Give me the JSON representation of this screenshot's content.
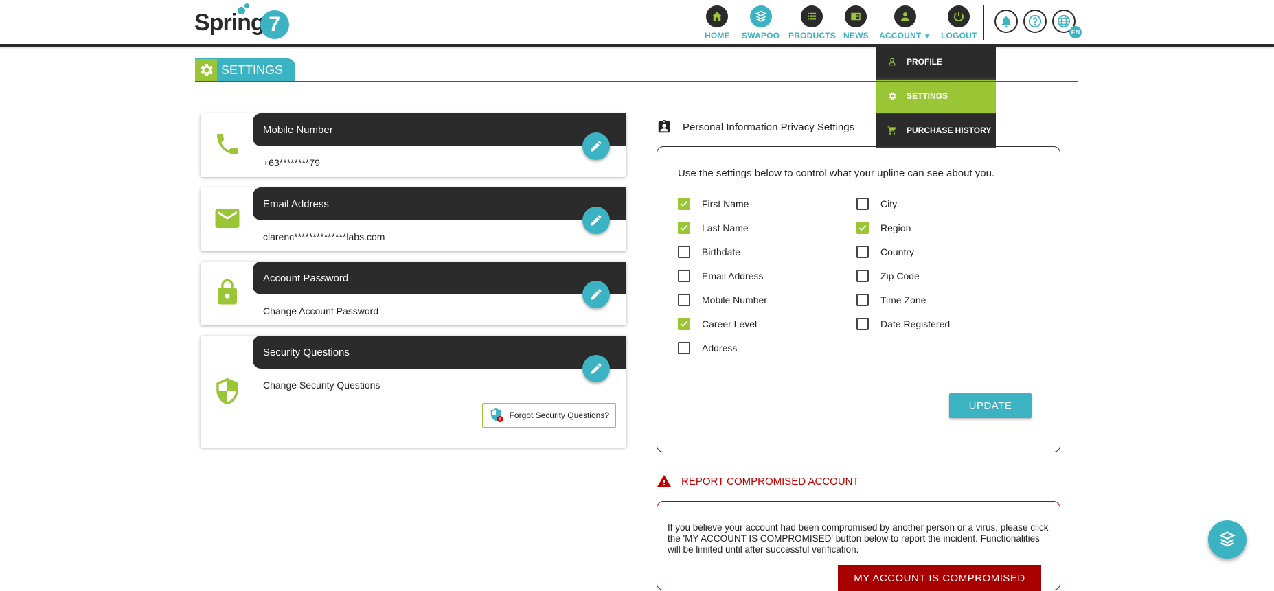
{
  "brand": {
    "logo_text": "Spring",
    "logo_number": "7"
  },
  "nav": {
    "home": "HOME",
    "swapoo": "SWAPOO",
    "products": "PRODUCTS",
    "news": "NEWS",
    "account": "ACCOUNT",
    "logout": "LOGOUT",
    "language": "EN"
  },
  "account_menu": {
    "items": [
      {
        "label": "PROFILE",
        "icon": "person-icon"
      },
      {
        "label": "SETTINGS",
        "icon": "gear-icon",
        "active": true
      },
      {
        "label": "PURCHASE HISTORY",
        "icon": "cart-icon"
      }
    ]
  },
  "page": {
    "title": "SETTINGS"
  },
  "cards": [
    {
      "title": "Mobile Number",
      "value": "+63********79",
      "icon": "phone-icon"
    },
    {
      "title": "Email Address",
      "value": "clarenc**************labs.com",
      "icon": "email-icon"
    },
    {
      "title": "Account Password",
      "value": "Change Account Password",
      "icon": "lock-icon"
    },
    {
      "title": "Security Questions",
      "value": "Change Security Questions",
      "icon": "shield-icon",
      "extra_button": "Forgot Security Questions?"
    }
  ],
  "privacy": {
    "title": "Personal Information Privacy Settings",
    "intro": "Use the settings below to control what your upline can see about you.",
    "left": [
      {
        "label": "First Name",
        "checked": true
      },
      {
        "label": "Last Name",
        "checked": true
      },
      {
        "label": "Birthdate",
        "checked": false
      },
      {
        "label": "Email Address",
        "checked": false
      },
      {
        "label": "Mobile Number",
        "checked": false
      },
      {
        "label": "Career Level",
        "checked": true
      },
      {
        "label": "Address",
        "checked": false
      }
    ],
    "right": [
      {
        "label": "City",
        "checked": false
      },
      {
        "label": "Region",
        "checked": true
      },
      {
        "label": "Country",
        "checked": false
      },
      {
        "label": "Zip Code",
        "checked": false
      },
      {
        "label": "Time Zone",
        "checked": false
      },
      {
        "label": "Date Registered",
        "checked": false
      }
    ],
    "update_label": "UPDATE"
  },
  "report": {
    "title": "REPORT COMPROMISED ACCOUNT",
    "text": "If you believe your account had been compromised by another person or a virus, please click the 'MY ACCOUNT IS COMPROMISED' button below to report the incident. Functionalities will be limited until after successful verification.",
    "button_label": "MY ACCOUNT IS COMPROMISED"
  },
  "colors": {
    "teal": "#3bb3c3",
    "green": "#9ac534",
    "dark": "#2b2b2b",
    "red": "#c00000"
  }
}
